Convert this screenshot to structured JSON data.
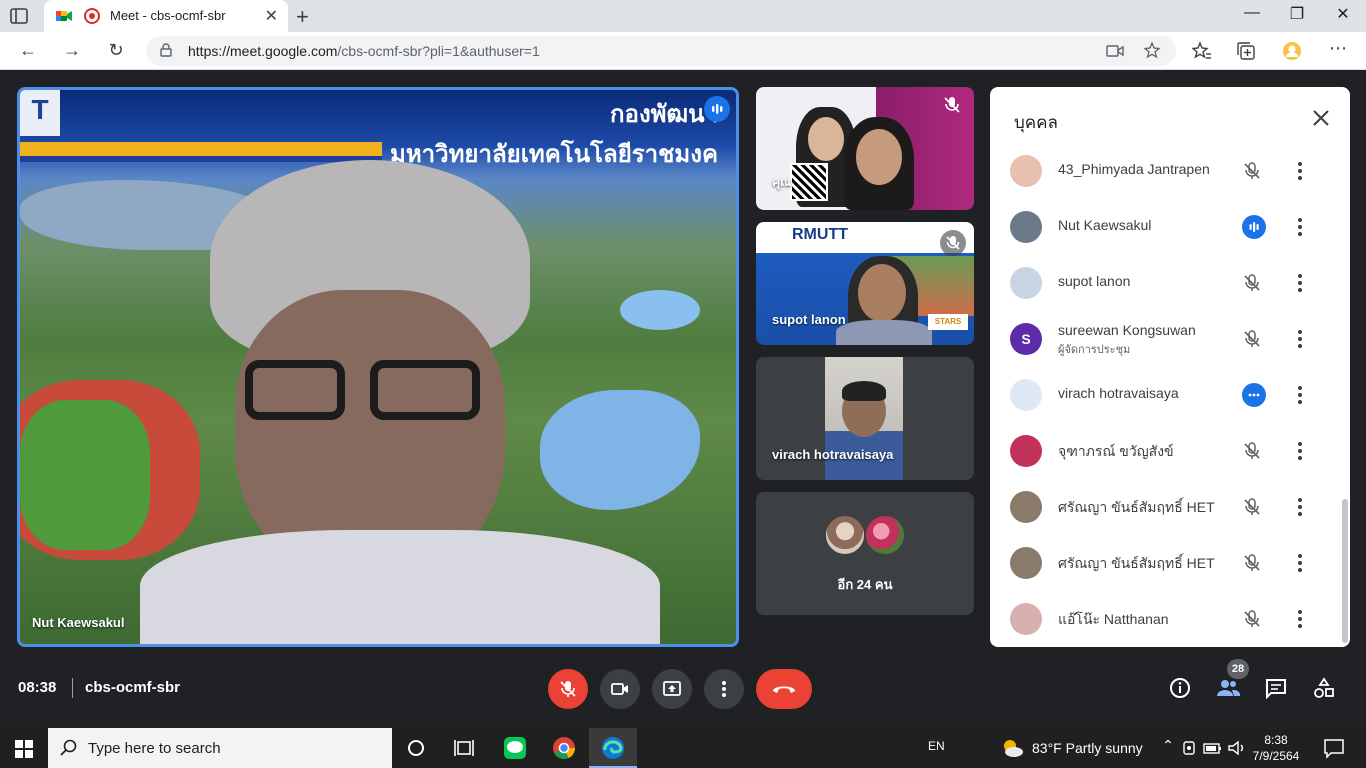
{
  "browser": {
    "tab_title": "Meet - cbs-ocmf-sbr",
    "url_host": "https://meet.google.com",
    "url_path": "/cbs-ocmf-sbr?pli=1&authuser=1"
  },
  "meeting": {
    "time": "08:38",
    "code": "cbs-ocmf-sbr",
    "participant_count": "28"
  },
  "main_tile": {
    "name": "Nut Kaewsakul",
    "slide_heading_1": "กองพัฒนา",
    "slide_heading_2": "มหาวิทยาลัยเทคโนโลยีราชมงค",
    "slide_logo": "T"
  },
  "side_tiles": [
    {
      "name": "คุณ"
    },
    {
      "name": "supot lanon",
      "slide_brand": "RMUTT",
      "slide_badge": "STARS"
    },
    {
      "name": "virach hotravaisaya"
    },
    {
      "more_label": "อีก 24 คน"
    }
  ],
  "people_panel": {
    "title": "บุคคล",
    "participants": [
      {
        "name": "43_Phimyada Jantrapen",
        "role": "",
        "status": "muted",
        "avatar_color": "#e8c0b0"
      },
      {
        "name": "Nut Kaewsakul",
        "role": "",
        "status": "speaking",
        "avatar_color": "#6a7a8a"
      },
      {
        "name": "supot lanon",
        "role": "",
        "status": "muted",
        "avatar_color": "#c8d4e4"
      },
      {
        "name": "sureewan Kongsuwan",
        "role": "ผู้จัดการประชุม",
        "status": "muted",
        "avatar_color": "#5e2bab",
        "initial": "S"
      },
      {
        "name": "virach hotravaisaya",
        "role": "",
        "status": "active",
        "avatar_color": "#dfe9f5"
      },
      {
        "name": "จุฑาภรณ์ ขวัญสังข์",
        "role": "",
        "status": "muted",
        "avatar_color": "#c2315a"
      },
      {
        "name": "ศรัณญา ขันธ์สัมฤทธิ์ HET",
        "role": "",
        "status": "muted",
        "avatar_color": "#8a7a6a"
      },
      {
        "name": "ศรัณญา ขันธ์สัมฤทธิ์ HET",
        "role": "",
        "status": "muted",
        "avatar_color": "#8a7a6a"
      },
      {
        "name": "แอ๊โน๊ะ Natthanan",
        "role": "",
        "status": "muted",
        "avatar_color": "#d9b0b0"
      }
    ]
  },
  "taskbar": {
    "search_placeholder": "Type here to search",
    "language": "EN",
    "weather": "83°F  Partly sunny",
    "clock_time": "8:38",
    "clock_date": "7/9/2564"
  },
  "colors": {
    "meet_bg": "#202124",
    "accent_blue": "#1a73e8",
    "danger_red": "#ea4335",
    "speaker_border": "#4d8fe8"
  }
}
